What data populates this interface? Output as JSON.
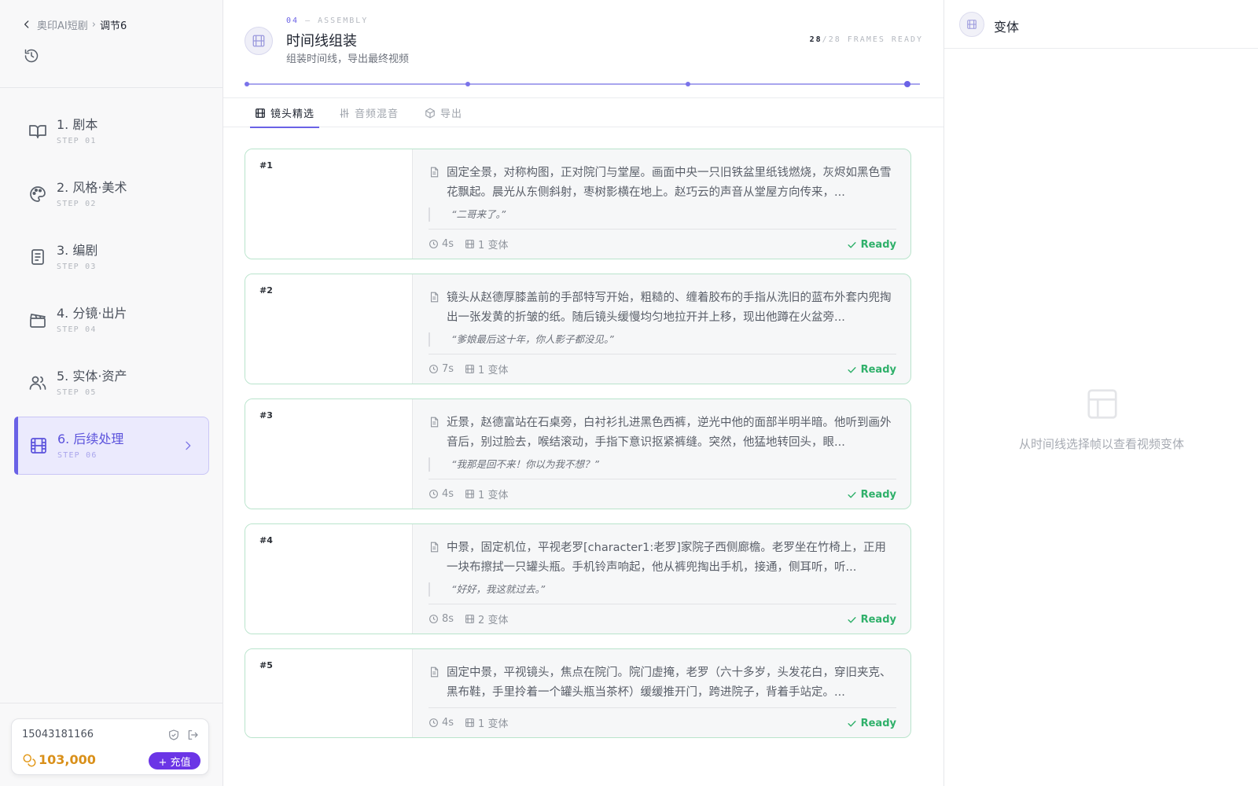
{
  "breadcrumb": {
    "parent": "奥印AI短剧",
    "separator": "›",
    "current": "调节6"
  },
  "sidebar": {
    "steps": [
      {
        "label": "1. 剧本",
        "sub": "STEP 01",
        "icon": "book-open-icon",
        "active": false
      },
      {
        "label": "2. 风格·美术",
        "sub": "STEP 02",
        "icon": "palette-icon",
        "active": false
      },
      {
        "label": "3. 编剧",
        "sub": "STEP 03",
        "icon": "script-icon",
        "active": false
      },
      {
        "label": "4. 分镜·出片",
        "sub": "STEP 04",
        "icon": "clapperboard-icon",
        "active": false
      },
      {
        "label": "5. 实体·资产",
        "sub": "STEP 05",
        "icon": "users-icon",
        "active": false
      },
      {
        "label": "6. 后续处理",
        "sub": "STEP 06",
        "icon": "film-icon",
        "active": true
      }
    ]
  },
  "account": {
    "phone": "15043181166",
    "balance": "103,000",
    "topup_label": "+ 充值"
  },
  "header": {
    "kicker_num": "04",
    "kicker_dash": "—",
    "kicker_text": "ASSEMBLY",
    "title": "时间线组装",
    "subtitle": "组装时间线，导出最终视频",
    "frames_ready": "28",
    "frames_total": "/28 FRAMES READY"
  },
  "tabs": [
    {
      "label": "镜头精选",
      "icon": "film-icon",
      "active": true
    },
    {
      "label": "音频混音",
      "icon": "sliders-icon",
      "active": false
    },
    {
      "label": "导出",
      "icon": "package-icon",
      "active": false
    }
  ],
  "shots": [
    {
      "number": "#1",
      "description": "固定全景，对称构图，正对院门与堂屋。画面中央一只旧铁盆里纸钱燃烧，灰烬如黑色雪花飘起。晨光从东侧斜射，枣树影横在地上。赵巧云的声音从堂屋方向传来，...",
      "dialogue": "“二哥来了。”",
      "duration": "4s",
      "variants": "1 变体",
      "status": "Ready"
    },
    {
      "number": "#2",
      "description": "镜头从赵德厚膝盖前的手部特写开始，粗糙的、缠着胶布的手指从洗旧的蓝布外套内兜掏出一张发黄的折皱的纸。随后镜头缓慢均匀地拉开并上移，现出他蹲在火盆旁...",
      "dialogue": "“爹娘最后这十年，你人影子都没见。”",
      "duration": "7s",
      "variants": "1 变体",
      "status": "Ready"
    },
    {
      "number": "#3",
      "description": "近景，赵德富站在石桌旁，白衬衫扎进黑色西裤，逆光中他的面部半明半暗。他听到画外音后，别过脸去，喉结滚动，手指下意识抠紧裤缝。突然，他猛地转回头，眼...",
      "dialogue": "“我那是回不来！你以为我不想？”",
      "duration": "4s",
      "variants": "1 变体",
      "status": "Ready"
    },
    {
      "number": "#4",
      "description": "中景，固定机位，平视老罗[character1:老罗]家院子西侧廊檐。老罗坐在竹椅上，正用一块布擦拭一只罐头瓶。手机铃声响起，他从裤兜掏出手机，接通，侧耳听，听...",
      "dialogue": "“好好，我这就过去。”",
      "duration": "8s",
      "variants": "2 变体",
      "status": "Ready"
    },
    {
      "number": "#5",
      "description": "固定中景，平视镜头，焦点在院门。院门虚掩，老罗（六十多岁，头发花白，穿旧夹克、黑布鞋，手里拎着一个罐头瓶当茶杯）缓缓推开门，跨进院子，背着手站定。...",
      "dialogue": "",
      "duration": "4s",
      "variants": "1 变体",
      "status": "Ready"
    }
  ],
  "right_panel": {
    "title": "变体",
    "empty_text": "从时间线选择帧以查看视频变体"
  },
  "colors": {
    "accent": "#6a62e6",
    "ready": "#2fb06a",
    "coin": "#d9901a",
    "topup": "#6b35e6"
  }
}
